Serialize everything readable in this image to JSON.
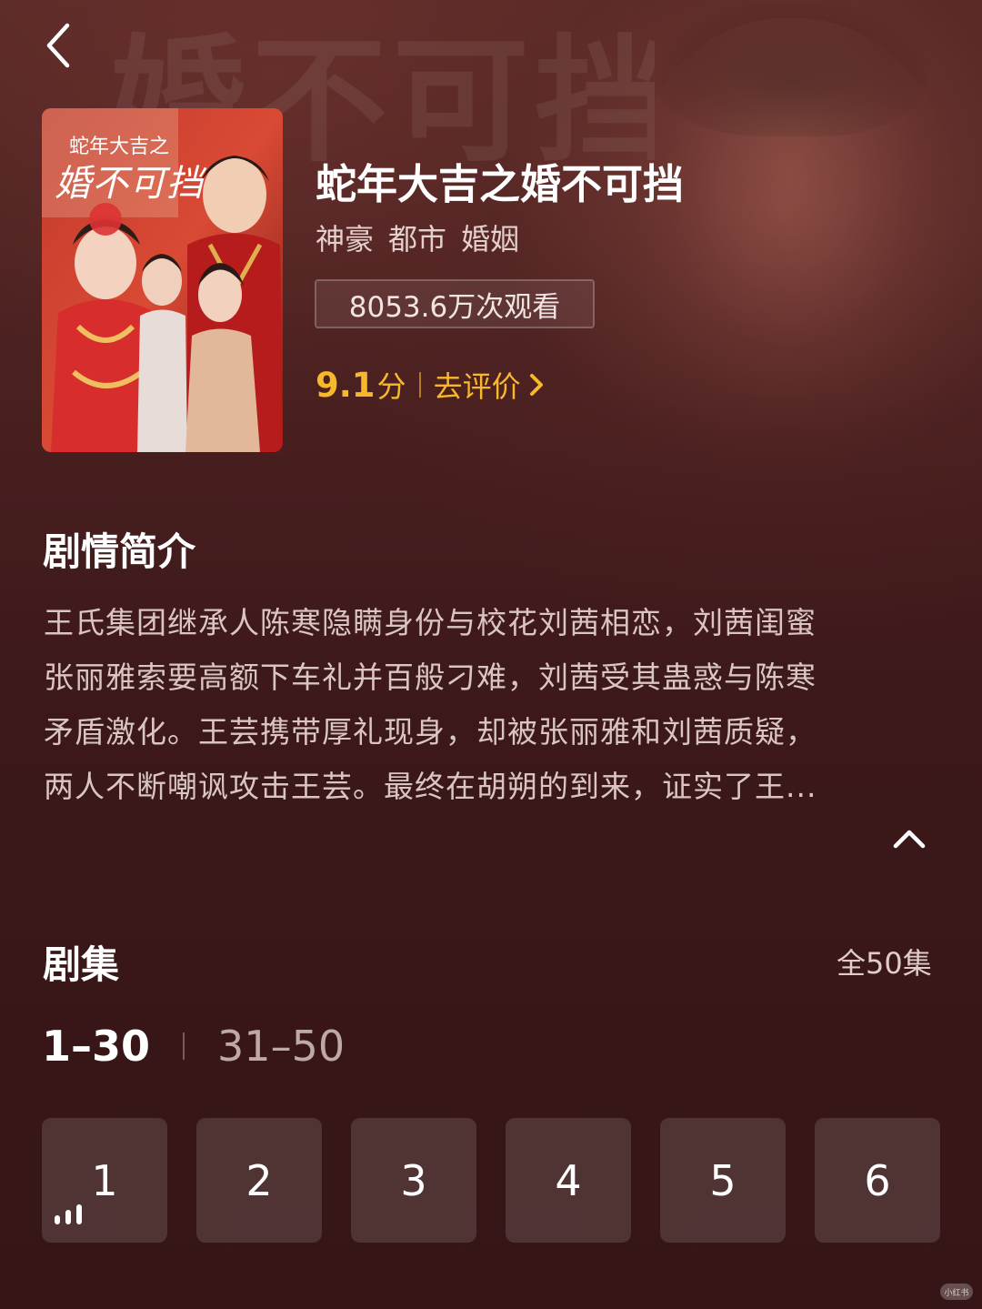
{
  "header": {
    "background_title": "婚不可挡"
  },
  "drama": {
    "title": "蛇年大吉之婚不可挡",
    "genres": [
      "神豪",
      "都市",
      "婚姻"
    ],
    "views": "8053.6万次观看",
    "rating": {
      "score": "9.1",
      "unit": "分",
      "rate_label": "去评价"
    },
    "poster": {
      "title_small": "蛇年大吉之",
      "title_big": "婚不可挡"
    }
  },
  "synopsis": {
    "title": "剧情简介",
    "lines": [
      "王氏集团继承人陈寒隐瞒身份与校花刘茜相恋，刘茜闺蜜",
      "张丽雅索要高额下车礼并百般刁难，刘茜受其蛊惑与陈寒",
      "矛盾激化。王芸携带厚礼现身，却被张丽雅和刘茜质疑，",
      "两人不断嘲讽攻击王芸。最终在胡朔的到来，证实了王..."
    ]
  },
  "episodes": {
    "title": "剧集",
    "total": "全50集",
    "ranges": [
      "1–30",
      "31–50"
    ],
    "active_range": "1–30",
    "items": [
      "1",
      "2",
      "3",
      "4",
      "5",
      "6"
    ],
    "playing": "1"
  },
  "colors": {
    "accent": "#f7b829",
    "background": "#3a1718",
    "tile": "#5a3534"
  },
  "icons": {
    "back": "chevron-left-icon",
    "rate": "chevron-right-icon",
    "collapse": "chevron-up-icon",
    "playing": "playing-bars-icon"
  },
  "watermark": "小红书"
}
